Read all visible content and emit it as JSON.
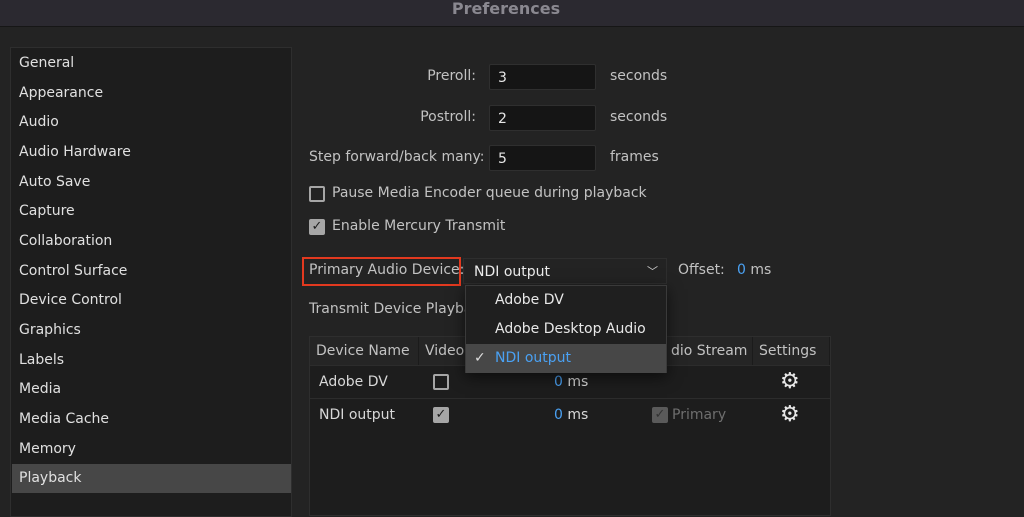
{
  "window": {
    "title": "Preferences"
  },
  "sidebar": {
    "items": [
      {
        "label": "General"
      },
      {
        "label": "Appearance"
      },
      {
        "label": "Audio"
      },
      {
        "label": "Audio Hardware"
      },
      {
        "label": "Auto Save"
      },
      {
        "label": "Capture"
      },
      {
        "label": "Collaboration"
      },
      {
        "label": "Control Surface"
      },
      {
        "label": "Device Control"
      },
      {
        "label": "Graphics"
      },
      {
        "label": "Labels"
      },
      {
        "label": "Media"
      },
      {
        "label": "Media Cache"
      },
      {
        "label": "Memory"
      },
      {
        "label": "Playback",
        "selected": true
      }
    ]
  },
  "form": {
    "preroll": {
      "label": "Preroll:",
      "value": "3",
      "unit": "seconds"
    },
    "postroll": {
      "label": "Postroll:",
      "value": "2",
      "unit": "seconds"
    },
    "step": {
      "label": "Step forward/back many:",
      "value": "5",
      "unit": "frames"
    },
    "pause_encoder": {
      "label": "Pause Media Encoder queue during playback",
      "checked": false
    },
    "mercury": {
      "label": "Enable Mercury Transmit",
      "checked": true
    },
    "primary_audio": {
      "label": "Primary Audio Device:",
      "value": "NDI output",
      "options": [
        "Adobe DV",
        "Adobe Desktop Audio",
        "NDI output"
      ]
    },
    "offset": {
      "label": "Offset:",
      "value": "0",
      "unit": "ms"
    },
    "transmit_label": "Transmit Device Playba"
  },
  "table": {
    "headers": [
      "Device Name",
      "Video",
      "dio Stream",
      "Settings"
    ],
    "rows": [
      {
        "name": "Adobe DV",
        "video": false,
        "offset": "0",
        "unit": "ms",
        "audio": ""
      },
      {
        "name": "NDI output",
        "video": true,
        "offset": "0",
        "unit": "ms",
        "audio": "Primary"
      }
    ]
  },
  "colors": {
    "accent": "#4aa1f3",
    "highlight": "#e2391f"
  }
}
